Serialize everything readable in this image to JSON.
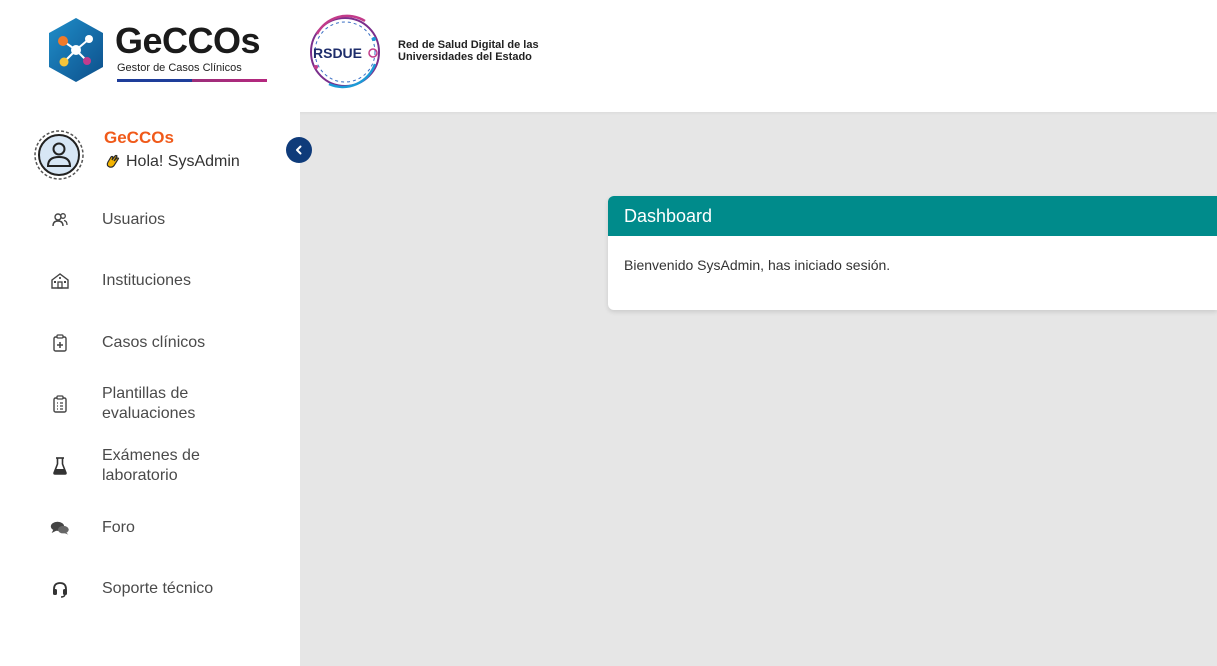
{
  "header": {
    "logo_title": "GeCCOs",
    "logo_subtitle": "Gestor de Casos Clínicos",
    "partner_mark": "RSDUE",
    "partner_name": "Red de Salud Digital de las\nUniversidades del Estado"
  },
  "sidebar": {
    "brand": "GeCCOs",
    "greeting": "Hola! SysAdmin",
    "items": [
      {
        "label": "Usuarios",
        "icon": "users-icon"
      },
      {
        "label": "Instituciones",
        "icon": "institution-icon"
      },
      {
        "label": "Casos clínicos",
        "icon": "clipboard-plus-icon"
      },
      {
        "label": "Plantillas de\nevaluaciones",
        "icon": "clipboard-list-icon"
      },
      {
        "label": "Exámenes de\nlaboratorio",
        "icon": "flask-icon"
      },
      {
        "label": "Foro",
        "icon": "chat-bubbles-icon"
      },
      {
        "label": "Soporte técnico",
        "icon": "headset-icon"
      }
    ]
  },
  "dashboard": {
    "title": "Dashboard",
    "message": "Bienvenido SysAdmin, has iniciado sesión."
  },
  "colors": {
    "brand_orange": "#f05a1a",
    "card_header": "#008b8b",
    "collapse_button": "#0f3b7a",
    "content_bg": "#e6e6e6"
  }
}
